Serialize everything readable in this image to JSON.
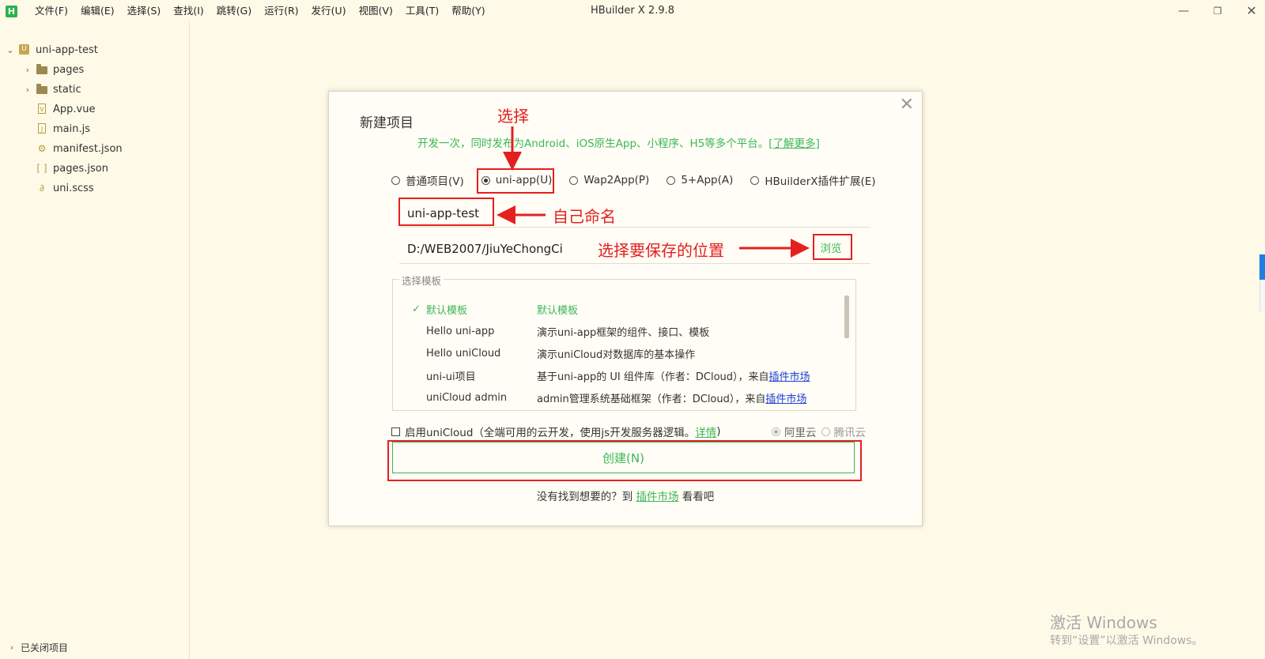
{
  "window": {
    "title": "HBuilder X 2.9.8"
  },
  "menu": [
    "文件(F)",
    "编辑(E)",
    "选择(S)",
    "查找(I)",
    "跳转(G)",
    "运行(R)",
    "发行(U)",
    "视图(V)",
    "工具(T)",
    "帮助(Y)"
  ],
  "sidebar": {
    "project": "uni-app-test",
    "items": [
      {
        "label": "pages",
        "icon": "folder-icon"
      },
      {
        "label": "static",
        "icon": "folder-icon"
      },
      {
        "label": "App.vue",
        "icon": "vue-file-icon"
      },
      {
        "label": "main.js",
        "icon": "js-file-icon"
      },
      {
        "label": "manifest.json",
        "icon": "manifest-icon"
      },
      {
        "label": "pages.json",
        "icon": "json-brackets-icon"
      },
      {
        "label": "uni.scss",
        "icon": "scss-file-icon"
      }
    ],
    "closed_projects": "已关闭项目"
  },
  "dialog": {
    "title": "新建项目",
    "subtitle": "开发一次，同时发布为Android、iOS原生App、小程序、H5等多个平台。",
    "learn_more": "[了解更多]",
    "project_types": [
      {
        "label": "普通项目(V)",
        "selected": false
      },
      {
        "label": "uni-app(U)",
        "selected": true
      },
      {
        "label": "Wap2App(P)",
        "selected": false
      },
      {
        "label": "5+App(A)",
        "selected": false
      },
      {
        "label": "HBuilderX插件扩展(E)",
        "selected": false
      }
    ],
    "project_name": "uni-app-test",
    "project_path": "D:/WEB2007/JiuYeChongCi",
    "browse": "浏览",
    "template_legend": "选择模板",
    "templates": [
      {
        "name": "默认模板",
        "desc": "默认模板",
        "selected": true
      },
      {
        "name": "Hello uni-app",
        "desc": "演示uni-app框架的组件、接口、模板"
      },
      {
        "name": "Hello uniCloud",
        "desc": "演示uniCloud对数据库的基本操作"
      },
      {
        "name": "uni-ui项目",
        "desc": "基于uni-app的 UI 组件库（作者：DCloud），来自",
        "link": "插件市场"
      },
      {
        "name": "uniCloud admin",
        "desc": "admin管理系统基础框架（作者：DCloud），来自",
        "link": "插件市场"
      }
    ],
    "unicloud": {
      "label": "启用uniCloud（全端可用的云开发，使用js开发服务器逻辑。",
      "details": "详情",
      "close_paren": ")",
      "providers": [
        {
          "label": "阿里云",
          "selected": true
        },
        {
          "label": "腾讯云",
          "selected": false
        }
      ]
    },
    "create_button": "创建(N)",
    "footer_hint_before": "没有找到想要的？到",
    "footer_hint_link": "插件市场",
    "footer_hint_after": "看看吧"
  },
  "annotations": {
    "select": "选择",
    "name_yourself": "自己命名",
    "choose_location": "选择要保存的位置"
  },
  "watermark": {
    "line1": "激活 Windows",
    "line2": "转到“设置”以激活 Windows。"
  },
  "colors": {
    "accent": "#3db658",
    "annotation": "#e3201f",
    "background": "#fffae8"
  }
}
